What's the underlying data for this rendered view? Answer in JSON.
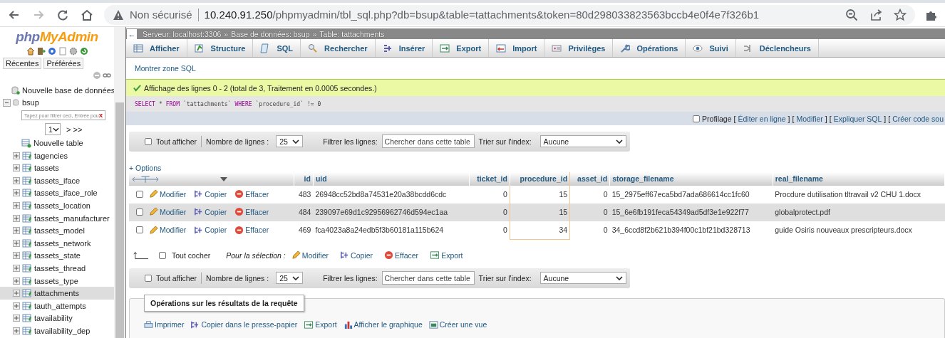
{
  "browser": {
    "forward_disabled": true,
    "security_label": "Non sécurisé",
    "url_host": "10.240.91.250",
    "url_path": "/phpmyadmin/tbl_sql.php?db=bsup&table=tattachments&token=80d298033823563bccb4e0f4e7f326b1"
  },
  "sidebar": {
    "logo_php": "php",
    "logo_myadmin": "MyAdmin",
    "buttons": [
      "Récentes",
      "Préférées"
    ],
    "new_database": "Nouvelle base de données",
    "database": {
      "name": "bsup",
      "expanded": true,
      "filter_placeholder": "Tapez pour filtrer ceci, Entrée pou",
      "filter_clear": "X",
      "page": "1",
      "page_nav": "> >>",
      "new_table": "Nouvelle table",
      "tables": [
        {
          "name": "tagencies",
          "selected": false
        },
        {
          "name": "tassets",
          "selected": false
        },
        {
          "name": "tassets_iface",
          "selected": false
        },
        {
          "name": "tassets_iface_role",
          "selected": false
        },
        {
          "name": "tassets_location",
          "selected": false
        },
        {
          "name": "tassets_manufacturer",
          "selected": false
        },
        {
          "name": "tassets_model",
          "selected": false
        },
        {
          "name": "tassets_network",
          "selected": false
        },
        {
          "name": "tassets_state",
          "selected": false
        },
        {
          "name": "tassets_thread",
          "selected": false
        },
        {
          "name": "tassets_type",
          "selected": false
        },
        {
          "name": "tattachments",
          "selected": true
        },
        {
          "name": "tauth_attempts",
          "selected": false
        },
        {
          "name": "tavailability",
          "selected": false
        },
        {
          "name": "tavailability_dep",
          "selected": false
        }
      ]
    }
  },
  "breadcrumb": {
    "collapse": "←",
    "separator": "»",
    "items": [
      "Serveur: localhost:3306",
      "Base de données: bsup",
      "Table: tattachments"
    ]
  },
  "tabs": [
    "Afficher",
    "Structure",
    "SQL",
    "Rechercher",
    "Insérer",
    "Export",
    "Import",
    "Privilèges",
    "Opérations",
    "Suivi",
    "Déclencheurs"
  ],
  "show_sql": "Montrer zone SQL",
  "message": "Affichage des lignes 0 - 2 (total de 3, Traitement en 0.0005 secondes.)",
  "sql_tokens": [
    {
      "text": "SELECT",
      "kind": "keyword"
    },
    {
      "text": "*",
      "kind": "operator"
    },
    {
      "text": "FROM",
      "kind": "keyword"
    },
    {
      "text": "`tattachments`",
      "kind": "identifier"
    },
    {
      "text": "WHERE",
      "kind": "keyword"
    },
    {
      "text": "`procedure_id`",
      "kind": "identifier"
    },
    {
      "text": "!=",
      "kind": "operator"
    },
    {
      "text": "0",
      "kind": "number"
    }
  ],
  "profiling": {
    "label": "Profilage",
    "checked": false,
    "open_bracket": "[",
    "close_bracket": "]",
    "links": [
      "Éditer en ligne",
      "Modifier",
      "Expliquer SQL",
      "Créer code sou"
    ]
  },
  "nav_bars": [
    {
      "show_all": "Tout afficher",
      "show_all_checked": false,
      "rows_label": "Nombre de lignes :",
      "rows_value": "25",
      "filter_label": "Filtrer les lignes:",
      "filter_placeholder": "Chercher dans cette table",
      "sort_label": "Trier sur l'index:",
      "sort_value": "Aucune"
    },
    {
      "show_all": "Tout afficher",
      "show_all_checked": false,
      "rows_label": "Nombre de lignes :",
      "rows_value": "25",
      "filter_label": "Filtrer les lignes:",
      "filter_placeholder": "Chercher dans cette table",
      "sort_label": "Trier sur l'index:",
      "sort_value": "Aucune"
    }
  ],
  "options": "+ Options",
  "table": {
    "columns": [
      {
        "label": "id",
        "kind": "number",
        "highlighted": false
      },
      {
        "label": "uid",
        "kind": "text",
        "highlighted": false
      },
      {
        "label": "ticket_id",
        "kind": "number",
        "highlighted": false
      },
      {
        "label": "procedure_id",
        "kind": "number",
        "highlighted": true
      },
      {
        "label": "asset_id",
        "kind": "number",
        "highlighted": false
      },
      {
        "label": "storage_filename",
        "kind": "text",
        "highlighted": false
      },
      {
        "label": "real_filename",
        "kind": "text",
        "highlighted": false
      }
    ],
    "rows": [
      {
        "checked": false,
        "actions": [
          "Modifier",
          "Copier",
          "Effacer"
        ],
        "cells": [
          "483",
          "26948cc52bd8a74531e20a38bcdd6cdc",
          "0",
          "15",
          "0",
          "15_2975eff67eca5bd7ada686614cc1fc60",
          "Procdure dutilisation tltravail v2 CHU 1.docx"
        ]
      },
      {
        "checked": false,
        "actions": [
          "Modifier",
          "Copier",
          "Effacer"
        ],
        "cells": [
          "484",
          "239097e69d1c92956962746d594ec1aa",
          "0",
          "15",
          "0",
          "15_6e6fb191feca54349ad5df3e1e922f77",
          "globalprotect.pdf"
        ]
      },
      {
        "checked": false,
        "actions": [
          "Modifier",
          "Copier",
          "Effacer"
        ],
        "cells": [
          "469",
          "fca4023a8a24edb5f3b60181a115b624",
          "0",
          "34",
          "0",
          "34_6ccd8f2b621b394f00c1bf21bd328713",
          "guide Osiris nouveaux prescripteurs.docx"
        ]
      }
    ]
  },
  "bulk": {
    "check_all": "Tout cocher",
    "checked": false,
    "label": "Pour la sélection :",
    "actions": [
      "Modifier",
      "Copier",
      "Effacer",
      "Export"
    ]
  },
  "operations": {
    "title": "Opérations sur les résultats de la requête",
    "links": [
      "Imprimer",
      "Copier dans le presse-papier",
      "Export",
      "Afficher le graphique",
      "Créer une vue"
    ]
  }
}
